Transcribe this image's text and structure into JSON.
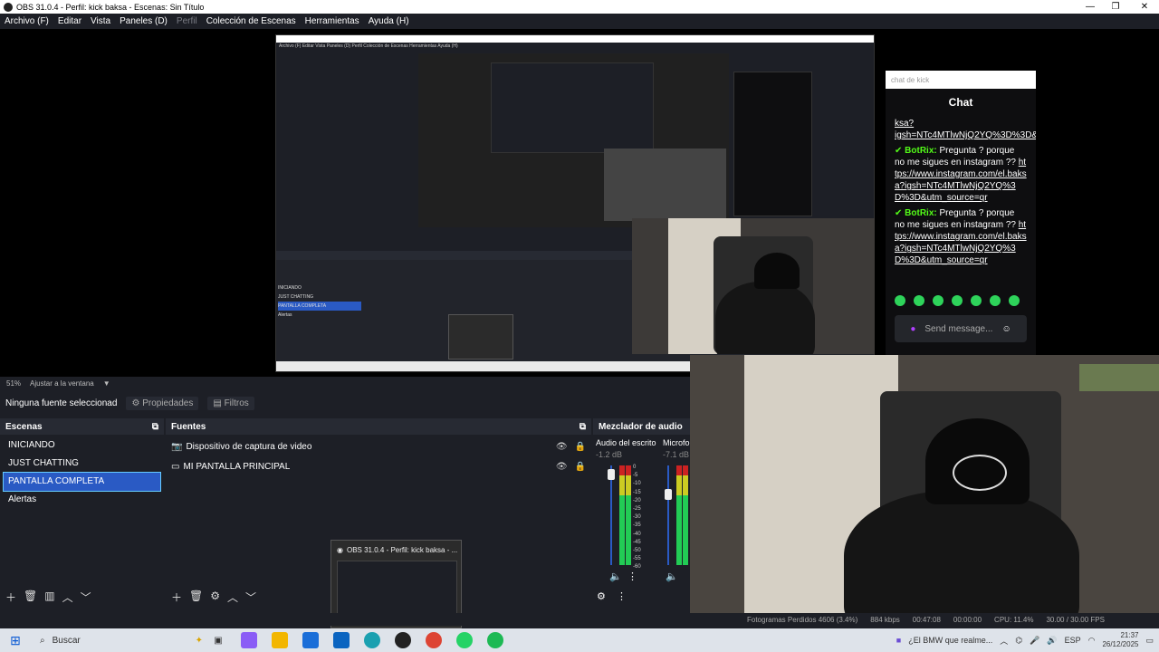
{
  "window": {
    "title": "OBS 31.0.4 - Perfil: kick baksa - Escenas: Sin Título"
  },
  "menu": [
    "Archivo (F)",
    "Editar",
    "Vista",
    "Paneles (D)",
    "Perfil",
    "Colección de Escenas",
    "Herramientas",
    "Ayuda (H)"
  ],
  "chat": {
    "search_placeholder": "chat de kick",
    "title": "Chat",
    "messages": [
      {
        "user": "",
        "text": "ksa?igsh=NTc4MTlwNjQ2YQ%3D%3D&utm_source=qr"
      },
      {
        "user": "BotRix:",
        "text": "Pregunta ? porque no me sigues en instagram ??",
        "link": "https://www.instagram.com/el.baksa?igsh=NTc4MTlwNjQ2YQ%3D%3D&utm_source=qr"
      },
      {
        "user": "BotRix:",
        "text": "Pregunta ? porque no me sigues en instagram ??",
        "link": "https://www.instagram.com/el.baksa?igsh=NTc4MTlwNjQ2YQ%3D%3D&utm_source=qr"
      }
    ],
    "send_placeholder": "Send message..."
  },
  "zoom": {
    "level": "51%",
    "fit": "Ajustar a la ventana"
  },
  "context": {
    "source": "Ninguna fuente seleccionad",
    "properties": "Propiedades",
    "filters": "Filtros"
  },
  "scenes": {
    "title": "Escenas",
    "items": [
      "INICIANDO",
      "JUST CHATTING",
      "PANTALLA COMPLETA",
      "Alertas"
    ],
    "selected": 2
  },
  "sources": {
    "title": "Fuentes",
    "items": [
      "Dispositivo de captura de video",
      "MI PANTALLA PRINCIPAL"
    ]
  },
  "mixer": {
    "title": "Mezclador de audio",
    "channels": [
      {
        "name": "Audio del escrito",
        "db": "-1.2 dB"
      },
      {
        "name": "Microfo",
        "db": "-7.1 dB"
      }
    ],
    "scale": [
      "0",
      "-5",
      "-10",
      "-15",
      "-20",
      "-25",
      "-30",
      "-35",
      "-40",
      "-45",
      "-50",
      "-55",
      "-60"
    ]
  },
  "popup": {
    "title": "OBS 31.0.4 - Perfil: kick baksa - ..."
  },
  "status": {
    "dropped": "Fotogramas Perdidos 4606 (3.4%)",
    "bitrate": "884 kbps",
    "time1": "00:47:08",
    "time2": "00:00:00",
    "cpu": "CPU: 11.4%",
    "fps": "30.00 / 30.00 FPS"
  },
  "taskbar": {
    "search": "Buscar",
    "news": "¿El BMW que realme...",
    "lang": "ESP",
    "time": "21:37",
    "date": "26/12/2025"
  },
  "colors": {
    "accent": "#2a5ac4",
    "kick_green": "#53fc18",
    "bg": "#1d1f26"
  }
}
